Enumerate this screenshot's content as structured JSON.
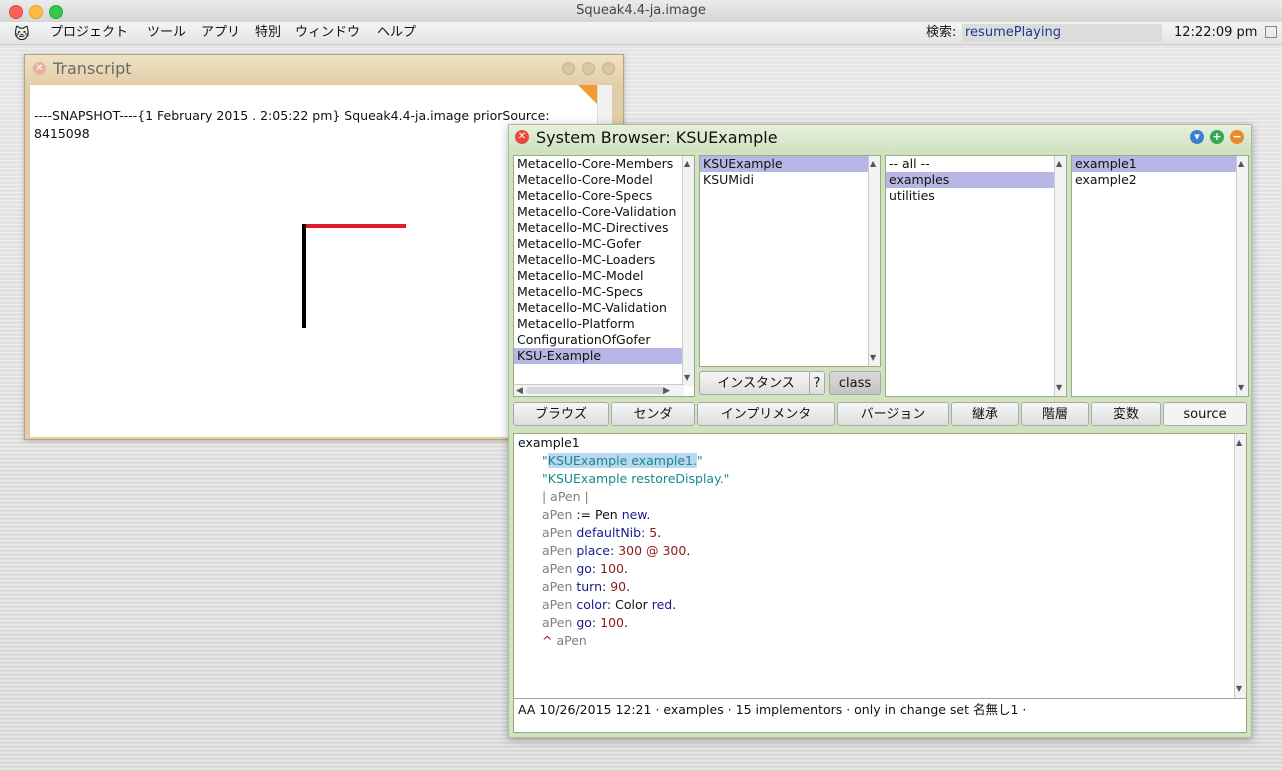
{
  "app": {
    "window_title": "Squeak4.4-ja.image"
  },
  "menubar": {
    "items": [
      "プロジェクト",
      "ツール",
      "アプリ",
      "特別",
      "ウィンドウ",
      "ヘルプ"
    ],
    "search_label": "検索:",
    "search_value": "resumePlaying",
    "clock": "12:22:09 pm"
  },
  "transcript": {
    "title": "Transcript",
    "text": "----SNAPSHOT----{1 February 2015 . 2:05:22 pm} Squeak4.4-ja.image priorSource: 8415098"
  },
  "browser": {
    "title": "System Browser: KSUExample",
    "packages": [
      "Metacello-Core-Members",
      "Metacello-Core-Model",
      "Metacello-Core-Specs",
      "Metacello-Core-Validation",
      "Metacello-MC-Directives",
      "Metacello-MC-Gofer",
      "Metacello-MC-Loaders",
      "Metacello-MC-Model",
      "Metacello-MC-Specs",
      "Metacello-MC-Validation",
      "Metacello-Platform",
      "ConfigurationOfGofer",
      "KSU-Example"
    ],
    "selected_package": "KSU-Example",
    "classes": [
      "KSUExample",
      "KSUMidi"
    ],
    "selected_class": "KSUExample",
    "protocols": [
      "-- all --",
      "examples",
      "utilities"
    ],
    "selected_protocol": "examples",
    "methods": [
      "example1",
      "example2"
    ],
    "selected_method": "example1",
    "class_buttons": {
      "instance": "インスタンス",
      "help": "?",
      "class": "class"
    },
    "toolbar": [
      "ブラウズ",
      "センダ",
      "インプリメンタ",
      "バージョン",
      "継承",
      "階層",
      "変数",
      "source"
    ],
    "code": {
      "header": "example1",
      "comment1": "KSUExample example1.",
      "comment2": "\"KSUExample restoreDisplay.\"",
      "temps": "| aPen |",
      "lines": [
        {
          "recv": "aPen",
          "rest_kw": "",
          "rest": " := Pen ",
          "kw2": "new",
          "tail": "."
        },
        {
          "recv": "aPen",
          "rest_kw": " defaultNib:",
          "rest": "",
          "num": " 5",
          "tail": "."
        },
        {
          "recv": "aPen",
          "rest_kw": " place:",
          "rest": "",
          "num": " 300 @ 300",
          "tail": "."
        },
        {
          "recv": "aPen",
          "rest_kw": " go:",
          "rest": "",
          "num": " 100",
          "tail": "."
        },
        {
          "recv": "aPen",
          "rest_kw": " turn:",
          "rest": "",
          "num": " 90",
          "tail": "."
        },
        {
          "recv": "aPen",
          "rest_kw": " color:",
          "rest": " Color ",
          "kw2": "red",
          "tail": "."
        },
        {
          "recv": "aPen",
          "rest_kw": " go:",
          "rest": "",
          "num": " 100",
          "tail": "."
        }
      ],
      "return_sym": "^",
      "return_var": "aPen"
    },
    "status": "AA 10/26/2015 12:21 · examples · 15 implementors · only in change set 名無し1  ·"
  }
}
